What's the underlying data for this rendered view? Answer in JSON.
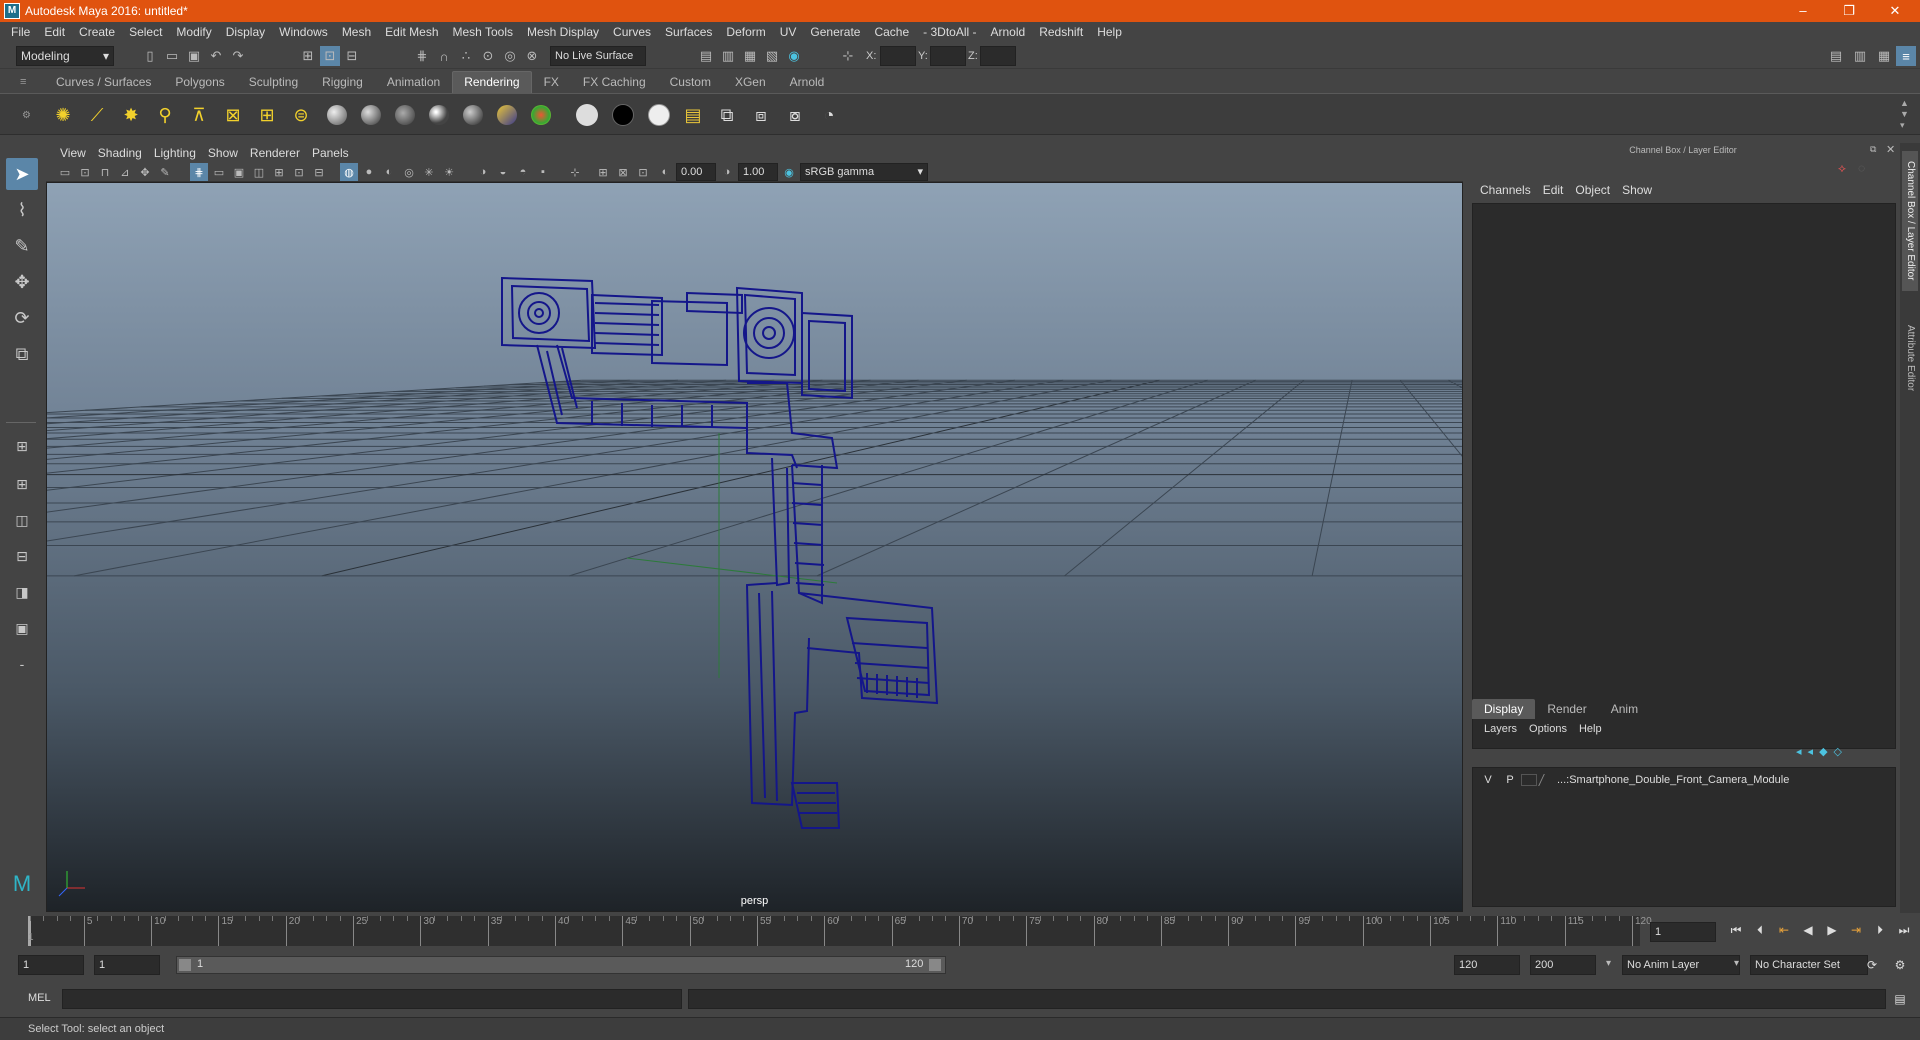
{
  "window": {
    "title": "Autodesk Maya 2016: untitled*",
    "logo": "M",
    "minimize": "–",
    "maximize": "❐",
    "close": "✕"
  },
  "menus": [
    "File",
    "Edit",
    "Create",
    "Select",
    "Modify",
    "Display",
    "Windows",
    "Mesh",
    "Edit Mesh",
    "Mesh Tools",
    "Mesh Display",
    "Curves",
    "Surfaces",
    "Deform",
    "UV",
    "Generate",
    "Cache",
    "- 3DtoAll -",
    "Arnold",
    "Redshift",
    "Help"
  ],
  "status_line": {
    "menu_set": "Modeling",
    "live_surface": "No Live Surface",
    "x_label": "X:",
    "y_label": "Y:",
    "z_label": "Z:"
  },
  "shelf_tabs": [
    {
      "label": "Curves / Surfaces",
      "active": false
    },
    {
      "label": "Polygons",
      "active": false
    },
    {
      "label": "Sculpting",
      "active": false
    },
    {
      "label": "Rigging",
      "active": false
    },
    {
      "label": "Animation",
      "active": false
    },
    {
      "label": "Rendering",
      "active": true
    },
    {
      "label": "FX",
      "active": false
    },
    {
      "label": "FX Caching",
      "active": false
    },
    {
      "label": "Custom",
      "active": false
    },
    {
      "label": "XGen",
      "active": false
    },
    {
      "label": "Arnold",
      "active": false
    }
  ],
  "panel": {
    "menus": [
      "View",
      "Shading",
      "Lighting",
      "Show",
      "Renderer",
      "Panels"
    ],
    "exposure": "0.00",
    "gamma": "1.00",
    "color_space": "sRGB gamma",
    "camera_label": "persp"
  },
  "channel_box": {
    "title": "Channel Box / Layer Editor",
    "menus": [
      "Channels",
      "Edit",
      "Object",
      "Show"
    ],
    "layer_tabs": [
      {
        "label": "Display",
        "active": true
      },
      {
        "label": "Render",
        "active": false
      },
      {
        "label": "Anim",
        "active": false
      }
    ],
    "layer_menus": [
      "Layers",
      "Options",
      "Help"
    ],
    "layer": {
      "v": "V",
      "p": "P",
      "name": "...:Smartphone_Double_Front_Camera_Module"
    }
  },
  "side_tabs": [
    "Channel Box / Layer Editor",
    "Attribute Editor"
  ],
  "timeline": {
    "ticks": [
      5,
      10,
      15,
      20,
      25,
      30,
      35,
      40,
      45,
      50,
      55,
      60,
      65,
      70,
      75,
      80,
      85,
      90,
      95,
      100,
      105,
      110,
      115,
      120
    ],
    "first_label": "1",
    "current_frame": "1",
    "start": 1,
    "end": 120
  },
  "range": {
    "start": "1",
    "playback_start": "1",
    "slider_start": "1",
    "slider_end": "120",
    "playback_end": "120",
    "end": "200",
    "anim_layer": "No Anim Layer",
    "character_set": "No Character Set"
  },
  "command_line": {
    "label": "MEL"
  },
  "help_line": {
    "text": "Select Tool: select an object"
  },
  "colors": {
    "titlebar": "#e0530f",
    "wireframe": "#1a1a8c",
    "selected": "#5b86a8"
  }
}
